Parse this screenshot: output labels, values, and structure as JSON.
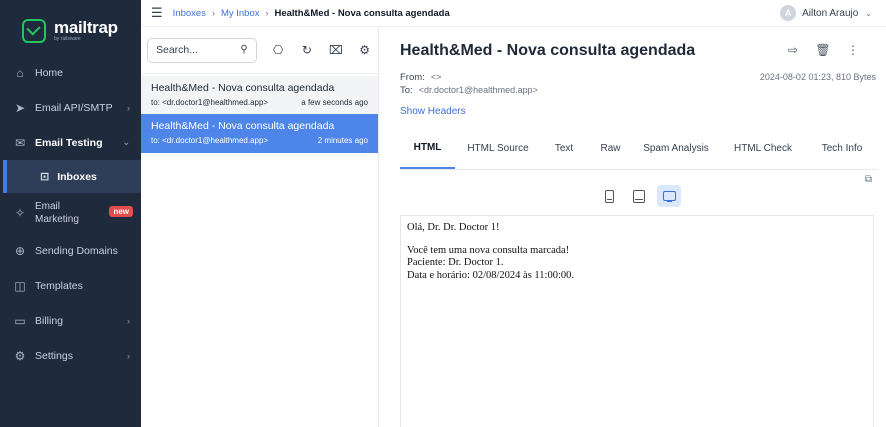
{
  "brand": {
    "name": "mailtrap",
    "sub": "by railsware",
    "accent": "#22c55e"
  },
  "sidebar": {
    "items": [
      {
        "label": "Home",
        "icon": "home-icon"
      },
      {
        "label": "Email API/SMTP",
        "icon": "send-icon"
      },
      {
        "label": "Email Testing",
        "icon": "mail-check-icon"
      },
      {
        "label": "Inboxes",
        "icon": "inbox-icon"
      },
      {
        "label": "Email",
        "label2": "Marketing",
        "badge": "new",
        "icon": "sparkle-icon"
      },
      {
        "label": "Sending Domains",
        "icon": "globe-icon"
      },
      {
        "label": "Templates",
        "icon": "template-icon"
      },
      {
        "label": "Billing",
        "icon": "card-icon"
      },
      {
        "label": "Settings",
        "icon": "gear-icon"
      }
    ]
  },
  "breadcrumb": {
    "inboxes": "Inboxes",
    "my_inbox": "My Inbox",
    "current": "Health&Med - Nova consulta agendada"
  },
  "user": {
    "initial": "A",
    "name": "Ailton Araujo"
  },
  "search": {
    "placeholder": "Search..."
  },
  "messages": [
    {
      "subject": "Health&Med - Nova consulta agendada",
      "to": "to: <dr.doctor1@healthmed.app>",
      "time": "a few seconds ago"
    },
    {
      "subject": "Health&Med - Nova consulta agendada",
      "to": "to: <dr.doctor1@healthmed.app>",
      "time": "2 minutes ago"
    }
  ],
  "detail": {
    "title": "Health&Med - Nova consulta agendada",
    "from_label": "From:",
    "from_value": "<>",
    "to_label": "To:",
    "to_value": "<dr.doctor1@healthmed.app>",
    "date": "2024-08-02 01:23, 810 Bytes",
    "show_headers": "Show Headers",
    "tabs": [
      "HTML",
      "HTML Source",
      "Text",
      "Raw",
      "Spam Analysis",
      "HTML Check",
      "Tech Info"
    ]
  },
  "body": {
    "greeting": "Olá, Dr. Dr. Doctor 1!",
    "line1": "Você tem uma nova consulta marcada!",
    "line2": "Paciente: Dr. Doctor 1.",
    "line3": "Data e horário: 02/08/2024 às 11:00:00."
  }
}
